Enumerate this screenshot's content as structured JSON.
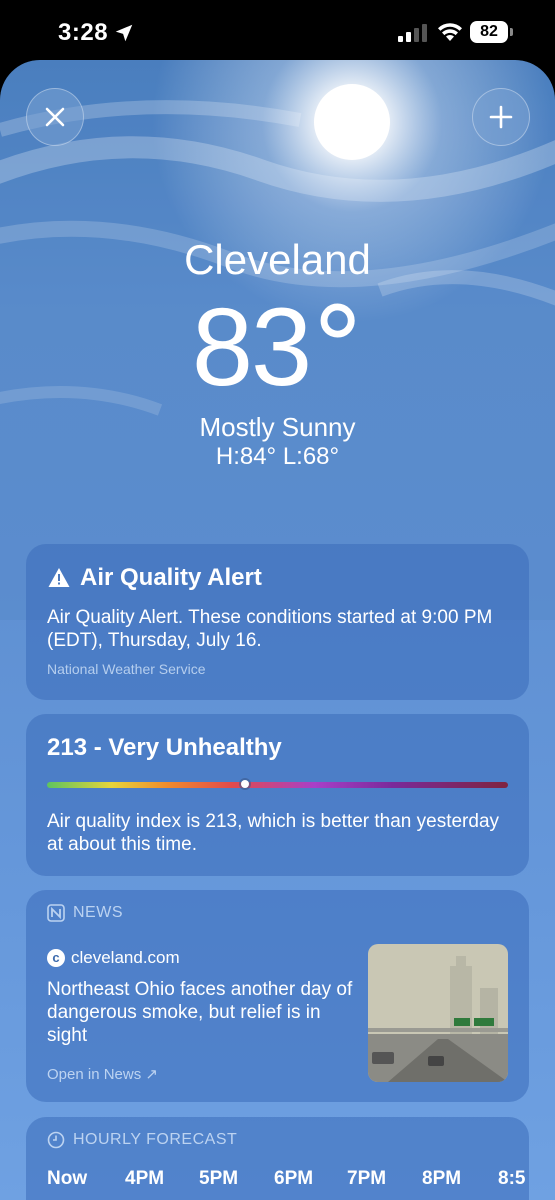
{
  "status_bar": {
    "time": "3:28",
    "battery": "82"
  },
  "weather": {
    "city": "Cleveland",
    "temperature": "83",
    "degree_symbol": "°",
    "condition": "Mostly Sunny",
    "high_low": "H:84°  L:68°"
  },
  "alert": {
    "title": "Air Quality Alert",
    "body": "Air Quality Alert. These conditions started at 9:00 PM (EDT), Thursday, July 16.",
    "source": "National Weather Service"
  },
  "air_quality": {
    "title": "213 - Very Unhealthy",
    "index": 213,
    "description": "Air quality index is 213, which is better than yesterday at about this time."
  },
  "news": {
    "header": "NEWS",
    "source": "cleveland.com",
    "headline": "Northeast Ohio faces another day of dangerous smoke, but relief is in sight",
    "open_link": "Open in News ↗"
  },
  "hourly": {
    "header": "HOURLY FORECAST",
    "hours": [
      "Now",
      "4PM",
      "5PM",
      "6PM",
      "7PM",
      "8PM",
      "8:5"
    ]
  },
  "colors": {
    "accent": "#5f90d2",
    "card": "#3a6cb9"
  }
}
